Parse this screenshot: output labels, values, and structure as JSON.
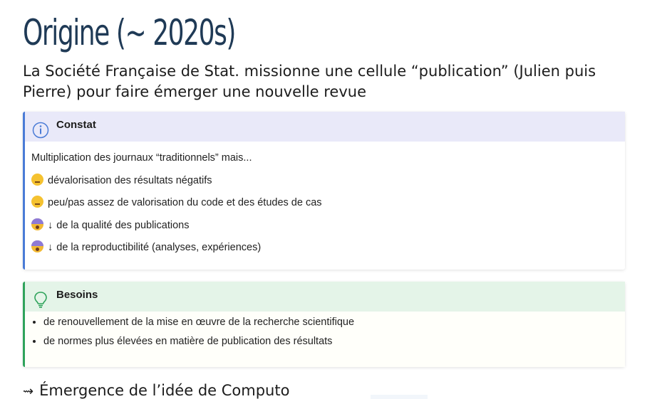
{
  "slide": {
    "title": "Origine (~ 2020s)",
    "subtitle": "La Société Française de Stat. missionne une cellule “publication” (Julien puis Pierre) pour faire émerger une nouvelle revue",
    "footer": {
      "arrow": "⇝",
      "text": "Émergence de l’idée de Computo"
    }
  },
  "constat": {
    "icon": "info-icon",
    "title": "Constat",
    "intro": "Multiplication des journaux “traditionnels” mais...",
    "items": [
      {
        "emoji": "sad-face-icon",
        "arrow": "",
        "text": "dévalorisation des résultats négatifs"
      },
      {
        "emoji": "worried-face-icon",
        "arrow": "",
        "text": "peu/pas assez de valorisation du code et des études de cas"
      },
      {
        "emoji": "screaming-face-icon",
        "arrow": "↓",
        "text": "de la qualité des publications"
      },
      {
        "emoji": "screaming-face-icon",
        "arrow": "↓",
        "text": "de la reproductibilité (analyses, expériences)"
      }
    ],
    "accent": "#4a7bd6"
  },
  "besoins": {
    "icon": "lightbulb-icon",
    "title": "Besoins",
    "items": [
      "de renouvellement de la mise en œuvre de la recherche scientifique",
      "de normes plus élevées en matière de publication des résultats"
    ],
    "accent": "#2fa35b"
  }
}
